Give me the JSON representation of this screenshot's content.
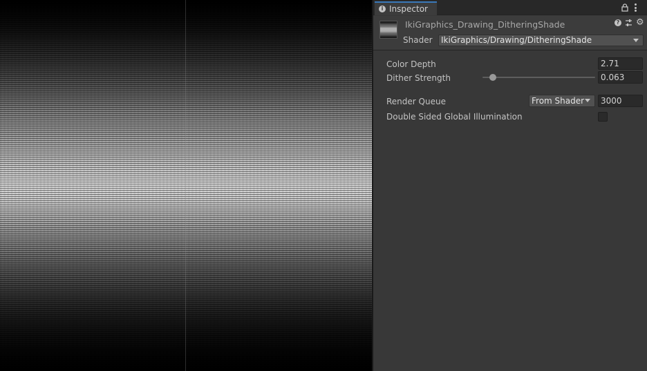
{
  "inspector": {
    "tab_label": "Inspector",
    "material": {
      "name": "IkiGraphics_Drawing_DitheringShade",
      "shader_label": "Shader",
      "shader_value": "IkiGraphics/Drawing/DitheringShade"
    },
    "properties": {
      "color_depth": {
        "label": "Color Depth",
        "value": "2.71"
      },
      "dither_strength": {
        "label": "Dither Strength",
        "value": "0.063",
        "slider_fraction": 0.063
      },
      "render_queue": {
        "label": "Render Queue",
        "mode": "From Shader",
        "value": "3000"
      },
      "double_sided_gi": {
        "label": "Double Sided Global Illumination",
        "checked": false
      }
    }
  },
  "icons": {
    "tab_icon": "info-icon",
    "lock": "lock-icon",
    "more": "kebab-menu-icon",
    "help": "help-icon",
    "preset": "preset-sliders-icon",
    "settings": "gear-icon"
  },
  "colors": {
    "tab_accent": "#3a79bb",
    "panel_bg": "#383838",
    "header_bg": "#3c3c3c"
  }
}
